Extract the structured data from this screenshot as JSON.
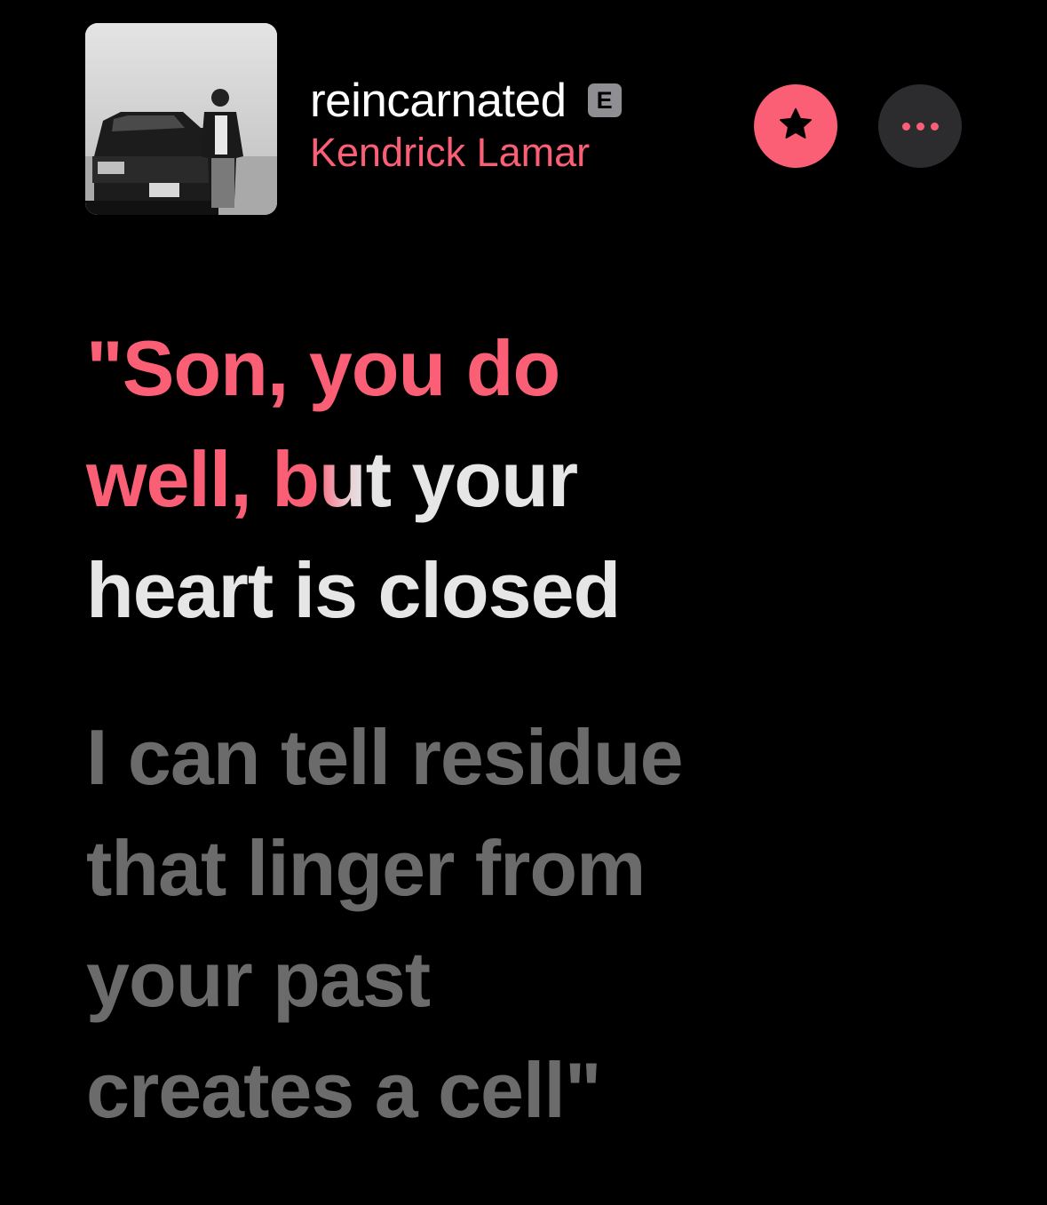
{
  "track": {
    "title": "reincarnated",
    "explicit_badge": "E",
    "artist": "Kendrick Lamar"
  },
  "controls": {
    "favorite_icon": "star-icon",
    "more_icon": "ellipsis-icon"
  },
  "lyrics": {
    "current": [
      {
        "sung": "\"Son, you do",
        "fade": "",
        "rest": ""
      },
      {
        "sung": "well, ",
        "fade": "bu",
        "rest": "t your"
      },
      {
        "sung": "",
        "fade": "",
        "rest": "heart is closed"
      }
    ],
    "next": [
      "I can tell residue",
      "that linger from",
      "your past",
      "creates a cell\""
    ]
  },
  "colors": {
    "accent": "#fa5f76",
    "background": "#000000",
    "active_text": "#e6e6e6",
    "upcoming_text": "#6b6b6b",
    "button_dark": "#2c2c2e"
  }
}
